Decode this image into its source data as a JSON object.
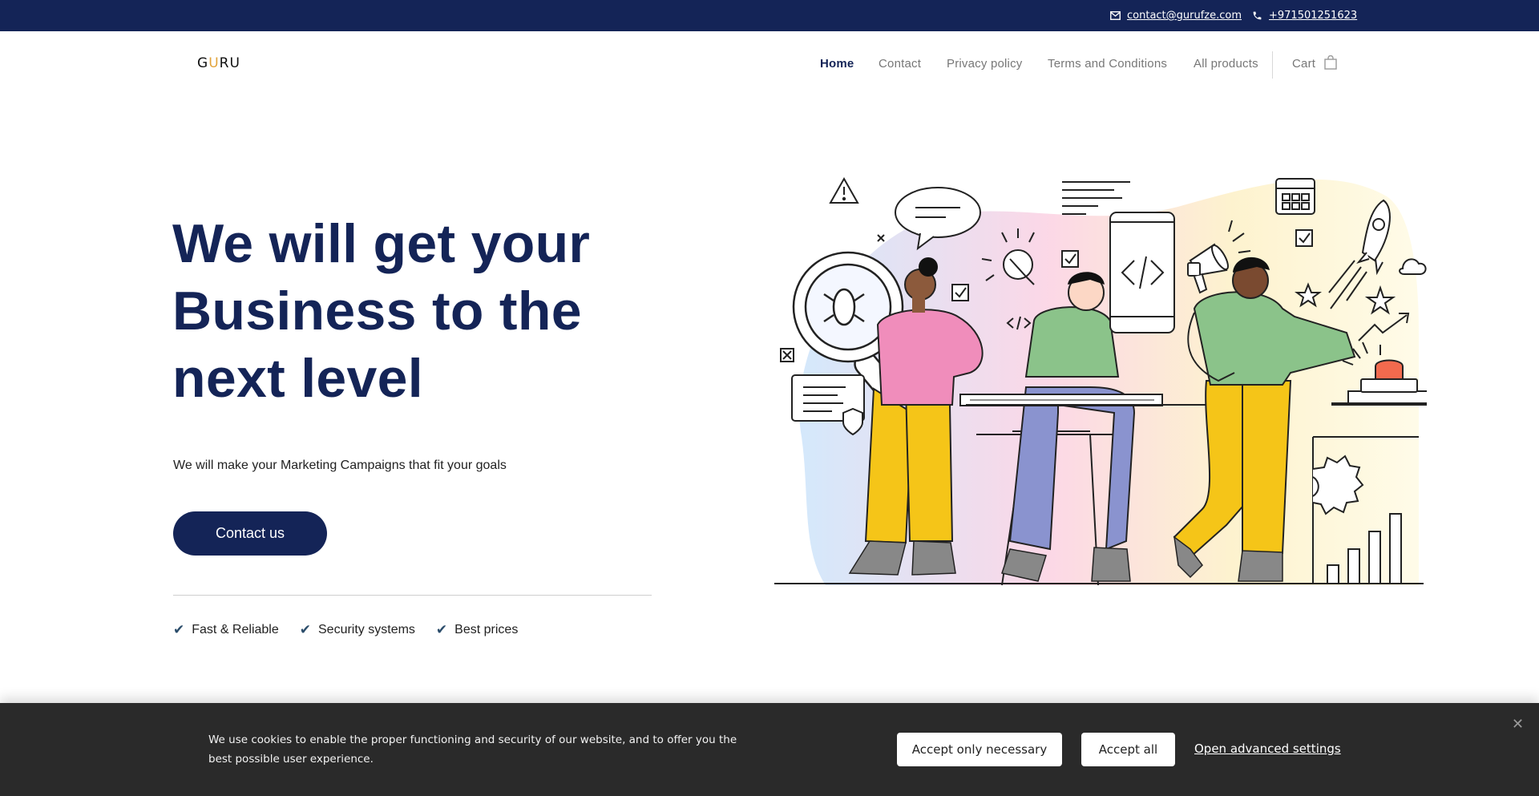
{
  "topbar": {
    "email": "contact@gurufze.com",
    "phone": "+971501251623",
    "email_icon": "mail-icon",
    "phone_icon": "phone-icon"
  },
  "header": {
    "logo_prefix": "G",
    "logo_accent": "U",
    "logo_suffix": "RU",
    "nav": [
      {
        "label": "Home",
        "active": true
      },
      {
        "label": "Contact",
        "active": false
      },
      {
        "label": "Privacy policy",
        "active": false
      },
      {
        "label": "Terms and Conditions",
        "active": false
      },
      {
        "label": "All products",
        "active": false
      }
    ],
    "cart_label": "Cart",
    "cart_icon": "shopping-bag-icon"
  },
  "hero": {
    "title_line1": "We will get your",
    "title_line2": "Business to the",
    "title_line3": "next level",
    "subtitle": "We will make your Marketing Campaigns that fit your goals",
    "cta_label": "Contact us",
    "features": [
      "Fast & Reliable",
      "Security systems",
      "Best prices"
    ]
  },
  "cookie_bar": {
    "text": "We use cookies to enable the proper functioning and security of our website, and to offer you the best possible user experience.",
    "accept_necessary": "Accept only necessary",
    "accept_all": "Accept all",
    "advanced": "Open advanced settings",
    "close_icon": "close-icon"
  },
  "colors": {
    "primary": "#142457",
    "topbar_bg": "#142457",
    "cookie_bg": "#2a2a2a",
    "accent_yellow": "#f5c518",
    "accent_pink": "#f08dbb",
    "accent_green": "#8bc38a",
    "accent_purple": "#8a93cf"
  }
}
